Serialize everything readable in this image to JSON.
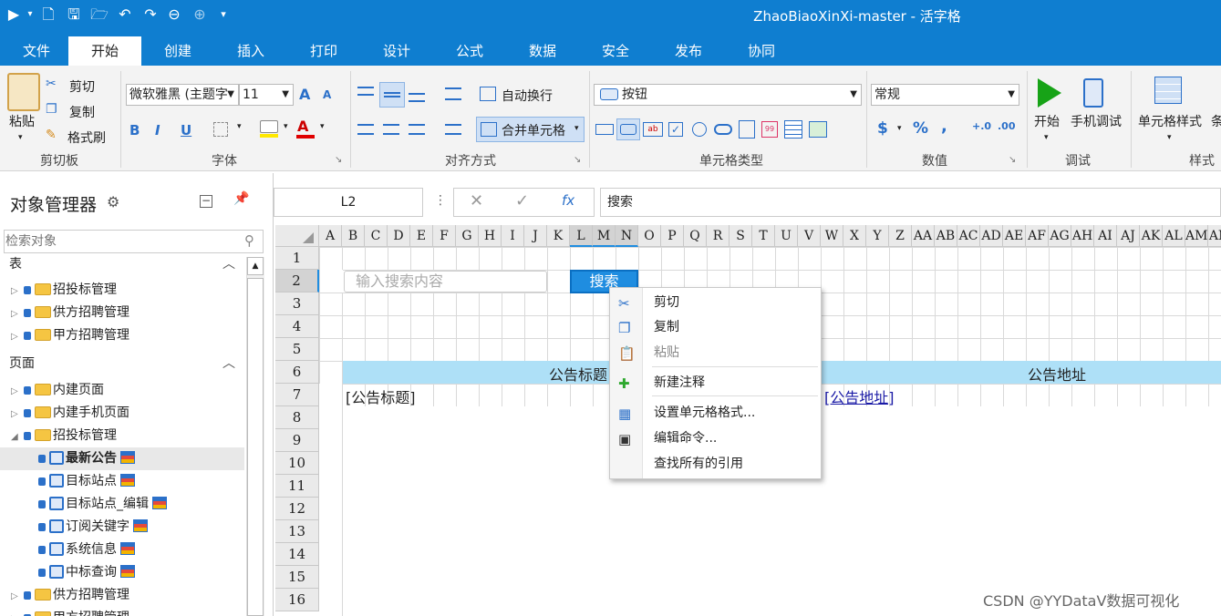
{
  "window": {
    "title": "ZhaoBiaoXinXi-master - 活字格"
  },
  "menu_tabs": [
    {
      "label": "文件"
    },
    {
      "label": "开始"
    },
    {
      "label": "创建"
    },
    {
      "label": "插入"
    },
    {
      "label": "打印"
    },
    {
      "label": "设计"
    },
    {
      "label": "公式"
    },
    {
      "label": "数据"
    },
    {
      "label": "安全"
    },
    {
      "label": "发布"
    },
    {
      "label": "协同"
    }
  ],
  "active_tab": "开始",
  "ribbon": {
    "clipboard": {
      "group": "剪切板",
      "paste": "粘贴",
      "cut": "剪切",
      "copy": "复制",
      "format_painter": "格式刷"
    },
    "font": {
      "group": "字体",
      "font_name": "微软雅黑 (主题字",
      "font_size": "11",
      "bold": "B",
      "italic": "I",
      "underline": "U",
      "grow": "A",
      "shrink": "A",
      "color_letter": "A"
    },
    "alignment": {
      "group": "对齐方式",
      "wrap": "自动换行",
      "merge": "合并单元格"
    },
    "cell_type": {
      "group": "单元格类型",
      "type_value": "按钮"
    },
    "number": {
      "group": "数值",
      "format": "常规",
      "currency": "$",
      "percent": "%",
      "comma": ","
    },
    "debug": {
      "group": "调试",
      "start": "开始",
      "mobile": "手机调试"
    },
    "style": {
      "group": "样式",
      "cell_style": "单元格样式",
      "cond": "条"
    }
  },
  "object_manager": {
    "title": "对象管理器",
    "search_placeholder": "检索对象",
    "tables_header": "表",
    "tables": [
      "招投标管理",
      "供方招聘管理",
      "甲方招聘管理"
    ],
    "pages_header": "页面",
    "pages": [
      "内建页面",
      "内建手机页面",
      "招投标管理"
    ],
    "sub_pages": [
      "最新公告",
      "目标站点",
      "目标站点_编辑",
      "订阅关键字",
      "系统信息",
      "中标查询"
    ],
    "more_pages": [
      "供方招聘管理",
      "甲方招聘管理"
    ]
  },
  "formula_bar": {
    "cell_ref": "L2",
    "value": "搜索",
    "fx": "fx"
  },
  "sheet": {
    "columns": [
      "A",
      "B",
      "C",
      "D",
      "E",
      "F",
      "G",
      "H",
      "I",
      "J",
      "K",
      "L",
      "M",
      "N",
      "O",
      "P",
      "Q",
      "R",
      "S",
      "T",
      "U",
      "V",
      "W",
      "X",
      "Y",
      "Z",
      "AA",
      "AB",
      "AC",
      "AD",
      "AE",
      "AF",
      "AG",
      "AH",
      "AI",
      "AJ",
      "AK",
      "AL",
      "AM",
      "AN"
    ],
    "rows": [
      "1",
      "2",
      "3",
      "4",
      "5",
      "6",
      "7",
      "8",
      "9",
      "10",
      "11",
      "12",
      "13",
      "14",
      "15",
      "16"
    ],
    "search_placeholder": "输入搜索内容",
    "search_button": "搜索",
    "header_title": "公告标题",
    "header_url": "公告地址",
    "cell_title": "[公告标题]",
    "cell_url": "[公告地址]"
  },
  "context_menu": {
    "items": [
      {
        "label": "剪切",
        "icon": "scissors-icon"
      },
      {
        "label": "复制",
        "icon": "copy-icon"
      },
      {
        "label": "粘贴",
        "icon": "paste-icon",
        "disabled": true
      },
      {
        "label": "新建注释",
        "icon": "new-note-icon"
      },
      {
        "label": "设置单元格格式...",
        "icon": "format-cells-icon"
      },
      {
        "label": "编辑命令...",
        "icon": "command-icon"
      },
      {
        "label": "查找所有的引用",
        "icon": "blank"
      }
    ]
  },
  "watermark": "CSDN @YYDataV数据可视化",
  "colors": {
    "brand": "#0f7ed0",
    "header_fill": "#aee0f7",
    "selection": "#1f8de0"
  }
}
